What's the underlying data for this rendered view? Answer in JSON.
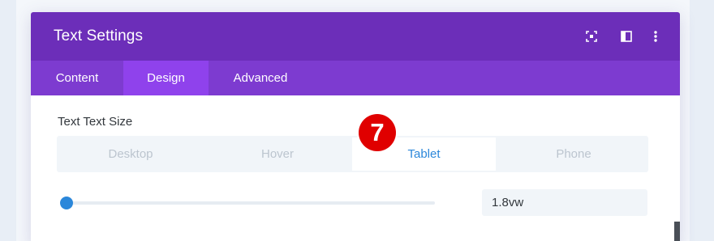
{
  "modal": {
    "title": "Text Settings",
    "icons": [
      "expand-icon",
      "sidebar-layout-icon",
      "more-options-icon"
    ]
  },
  "tabs": [
    {
      "label": "Content",
      "active": false
    },
    {
      "label": "Design",
      "active": true
    },
    {
      "label": "Advanced",
      "active": false
    }
  ],
  "field": {
    "label": "Text Text Size",
    "devices": [
      {
        "label": "Desktop",
        "active": false
      },
      {
        "label": "Hover",
        "active": false
      },
      {
        "label": "Tablet",
        "active": true
      },
      {
        "label": "Phone",
        "active": false
      }
    ],
    "slider_fraction": 0,
    "value": "1.8vw"
  },
  "step_badge": "7",
  "colors": {
    "header": "#6c2eb9",
    "tabs_bar": "#7d3bd0",
    "active_tab": "#8f42ec",
    "accent": "#2b87da",
    "badge": "#e00000"
  }
}
